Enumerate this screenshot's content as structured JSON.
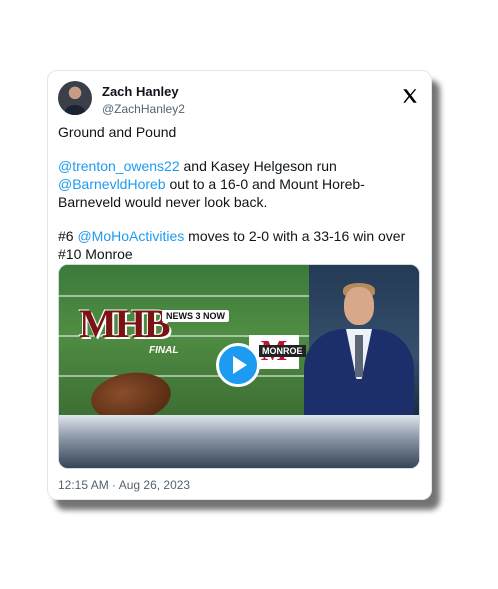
{
  "author": {
    "name": "Zach Hanley",
    "handle": "@ZachHanley2",
    "avatar_icon": "profile-avatar"
  },
  "platform_icon": "x-logo-icon",
  "tweet": {
    "line1": "Ground and Pound",
    "p2_link1": "@trenton_owens22",
    "p2_text1": " and Kasey Helgeson run ",
    "p2_link2": "@BarnevldHoreb",
    "p2_text2": " out to a 16-0 and Mount Horeb-Barneveld would never look back.",
    "p3_text1": "#6 ",
    "p3_link1": "@MoHoActivities",
    "p3_text2": " moves to 2-0 with a 33-16 win over #10 Monroe"
  },
  "media": {
    "type": "video",
    "play_icon": "play-icon",
    "overlay": {
      "logo_letters": "MHB",
      "news_badge": "NEWS 3 NOW",
      "final_text": "FINAL",
      "opponent_letter": "M",
      "opponent_label": "MONROE"
    }
  },
  "timestamp": "12:15 AM · Aug 26, 2023",
  "colors": {
    "link": "#1d9bf0",
    "text": "#0f1419",
    "muted": "#536471"
  }
}
